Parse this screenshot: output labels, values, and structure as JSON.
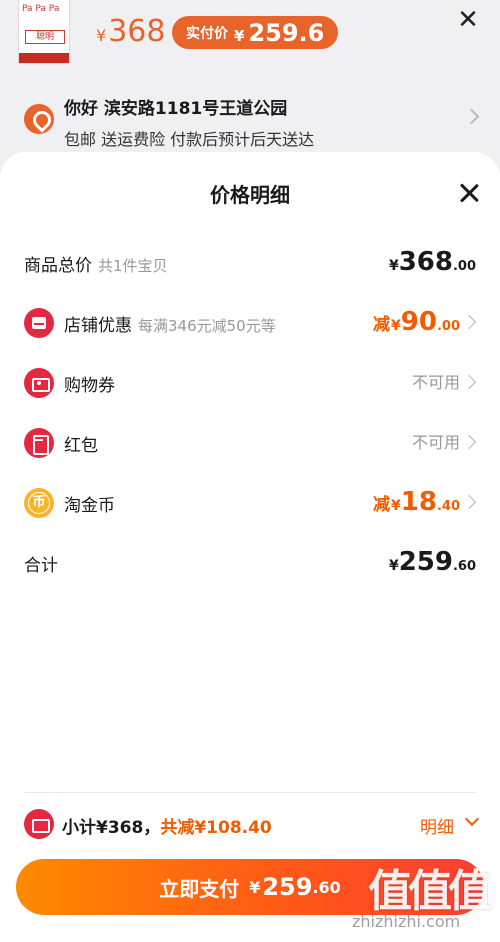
{
  "background": {
    "product_thumb_text_1": "Pa Pa Pa",
    "product_thumb_text_2": "聪明",
    "original_price_symbol": "¥",
    "original_price": "368",
    "pay_pill_label": "实付价",
    "pay_pill_symbol": "¥",
    "pay_pill_value": "259.6",
    "address_name": "你好 滨安路1181号王道公园",
    "address_sub": "包邮 送运费险 付款后预计后天送达"
  },
  "sheet": {
    "title": "价格明细",
    "rows": [
      {
        "label": "商品总价",
        "sub": "共1件宝贝",
        "yen": "¥",
        "int": "368",
        "dec": ".00"
      },
      {
        "label": "店铺优惠",
        "sub": "每满346元减50元等",
        "prefix": "减",
        "yen": "¥",
        "int": "90",
        "dec": ".00"
      },
      {
        "label": "购物券",
        "status": "不可用"
      },
      {
        "label": "红包",
        "status": "不可用"
      },
      {
        "label": "淘金币",
        "prefix": "减",
        "yen": "¥",
        "int": "18",
        "dec": ".40"
      },
      {
        "label": "合计",
        "yen": "¥",
        "int": "259",
        "dec": ".60"
      }
    ]
  },
  "footer": {
    "subtotal": "小计¥368，",
    "discount": "共减¥108.40",
    "detail": "明细"
  },
  "pay_button": {
    "label": "立即支付",
    "yen": "¥",
    "int": "259",
    "dec": ".60"
  },
  "watermark": {
    "big": "值值值",
    "small": "zhizhizhi.com"
  },
  "colors": {
    "accent": "#f25c00",
    "icon_red": "#e3283f",
    "coin": "#f6b52a"
  },
  "icons": {
    "close": "close-icon",
    "location": "location-icon",
    "shop": "shop-discount-icon",
    "coupon": "coupon-icon",
    "red_packet": "red-packet-icon",
    "coin": "taojinbi-coin-icon",
    "chevron": "chevron-right-icon"
  }
}
